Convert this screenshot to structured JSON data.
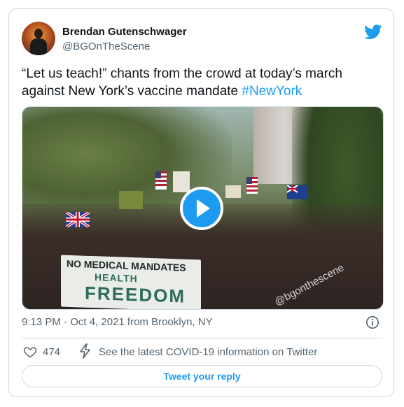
{
  "tweet": {
    "author_name": "Brendan Gutenschwager",
    "author_handle": "@BGOnTheScene",
    "text_main": "“Let us teach!” chants from the crowd at today’s march against New York’s vaccine mandate ",
    "hashtag": "#NewYork",
    "timestamp": "9:13 PM · Oct 4, 2021 from Brooklyn, NY",
    "like_count": "474",
    "covid_info": "See the latest COVID-19 information on Twitter",
    "reply_label": "Tweet your reply"
  },
  "media": {
    "banner_line1": "NO MEDICAL MANDATES",
    "banner_line2": "HEALTH",
    "banner_line3": "FREEDOM",
    "watermark": "@bgonthescene"
  },
  "icons": {
    "brand": "twitter-bird-icon",
    "play": "play-icon",
    "info": "info-icon",
    "like": "heart-icon",
    "covid": "lightning-icon"
  },
  "colors": {
    "accent": "#1d9bf0",
    "text": "#0f1419",
    "muted": "#536471",
    "border": "#cfd9de"
  }
}
